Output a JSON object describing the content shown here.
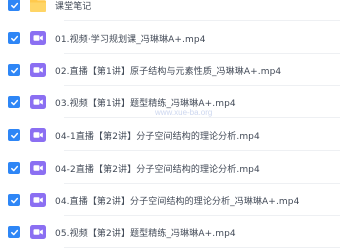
{
  "colors": {
    "checkbox": "#2e86f6",
    "video_icon": "#8b6ff2",
    "folder": "#ffc94d",
    "text": "#424a57",
    "divider": "#eef0f3"
  },
  "folder": {
    "name": "课堂笔记",
    "icon": "folder-icon"
  },
  "files": [
    {
      "name": "01.视频·学习规划课_冯琳琳A+.mp4",
      "checked": true,
      "icon": "video-file-icon"
    },
    {
      "name": "02.直播【第1讲】原子结构与元素性质_冯琳琳A+.mp4",
      "checked": true,
      "icon": "video-file-icon"
    },
    {
      "name": "03.视频【第1讲】题型精练_冯琳琳A+.mp4",
      "checked": true,
      "icon": "video-file-icon"
    },
    {
      "name": "04-1直播【第2讲】分子空间结构的理论分析.mp4",
      "checked": true,
      "icon": "video-file-icon"
    },
    {
      "name": "04-2直播【第2讲】分子空间结构的理论分析.mp4",
      "checked": true,
      "icon": "video-file-icon"
    },
    {
      "name": "04.直播【第2讲】分子空间结构的理论分析_冯琳琳A+.mp4",
      "checked": true,
      "icon": "video-file-icon"
    },
    {
      "name": "05.视频【第2讲】题型精练_冯琳琳A+.mp4",
      "checked": true,
      "icon": "video-file-icon"
    }
  ],
  "watermark": "www.xue-ba.org"
}
